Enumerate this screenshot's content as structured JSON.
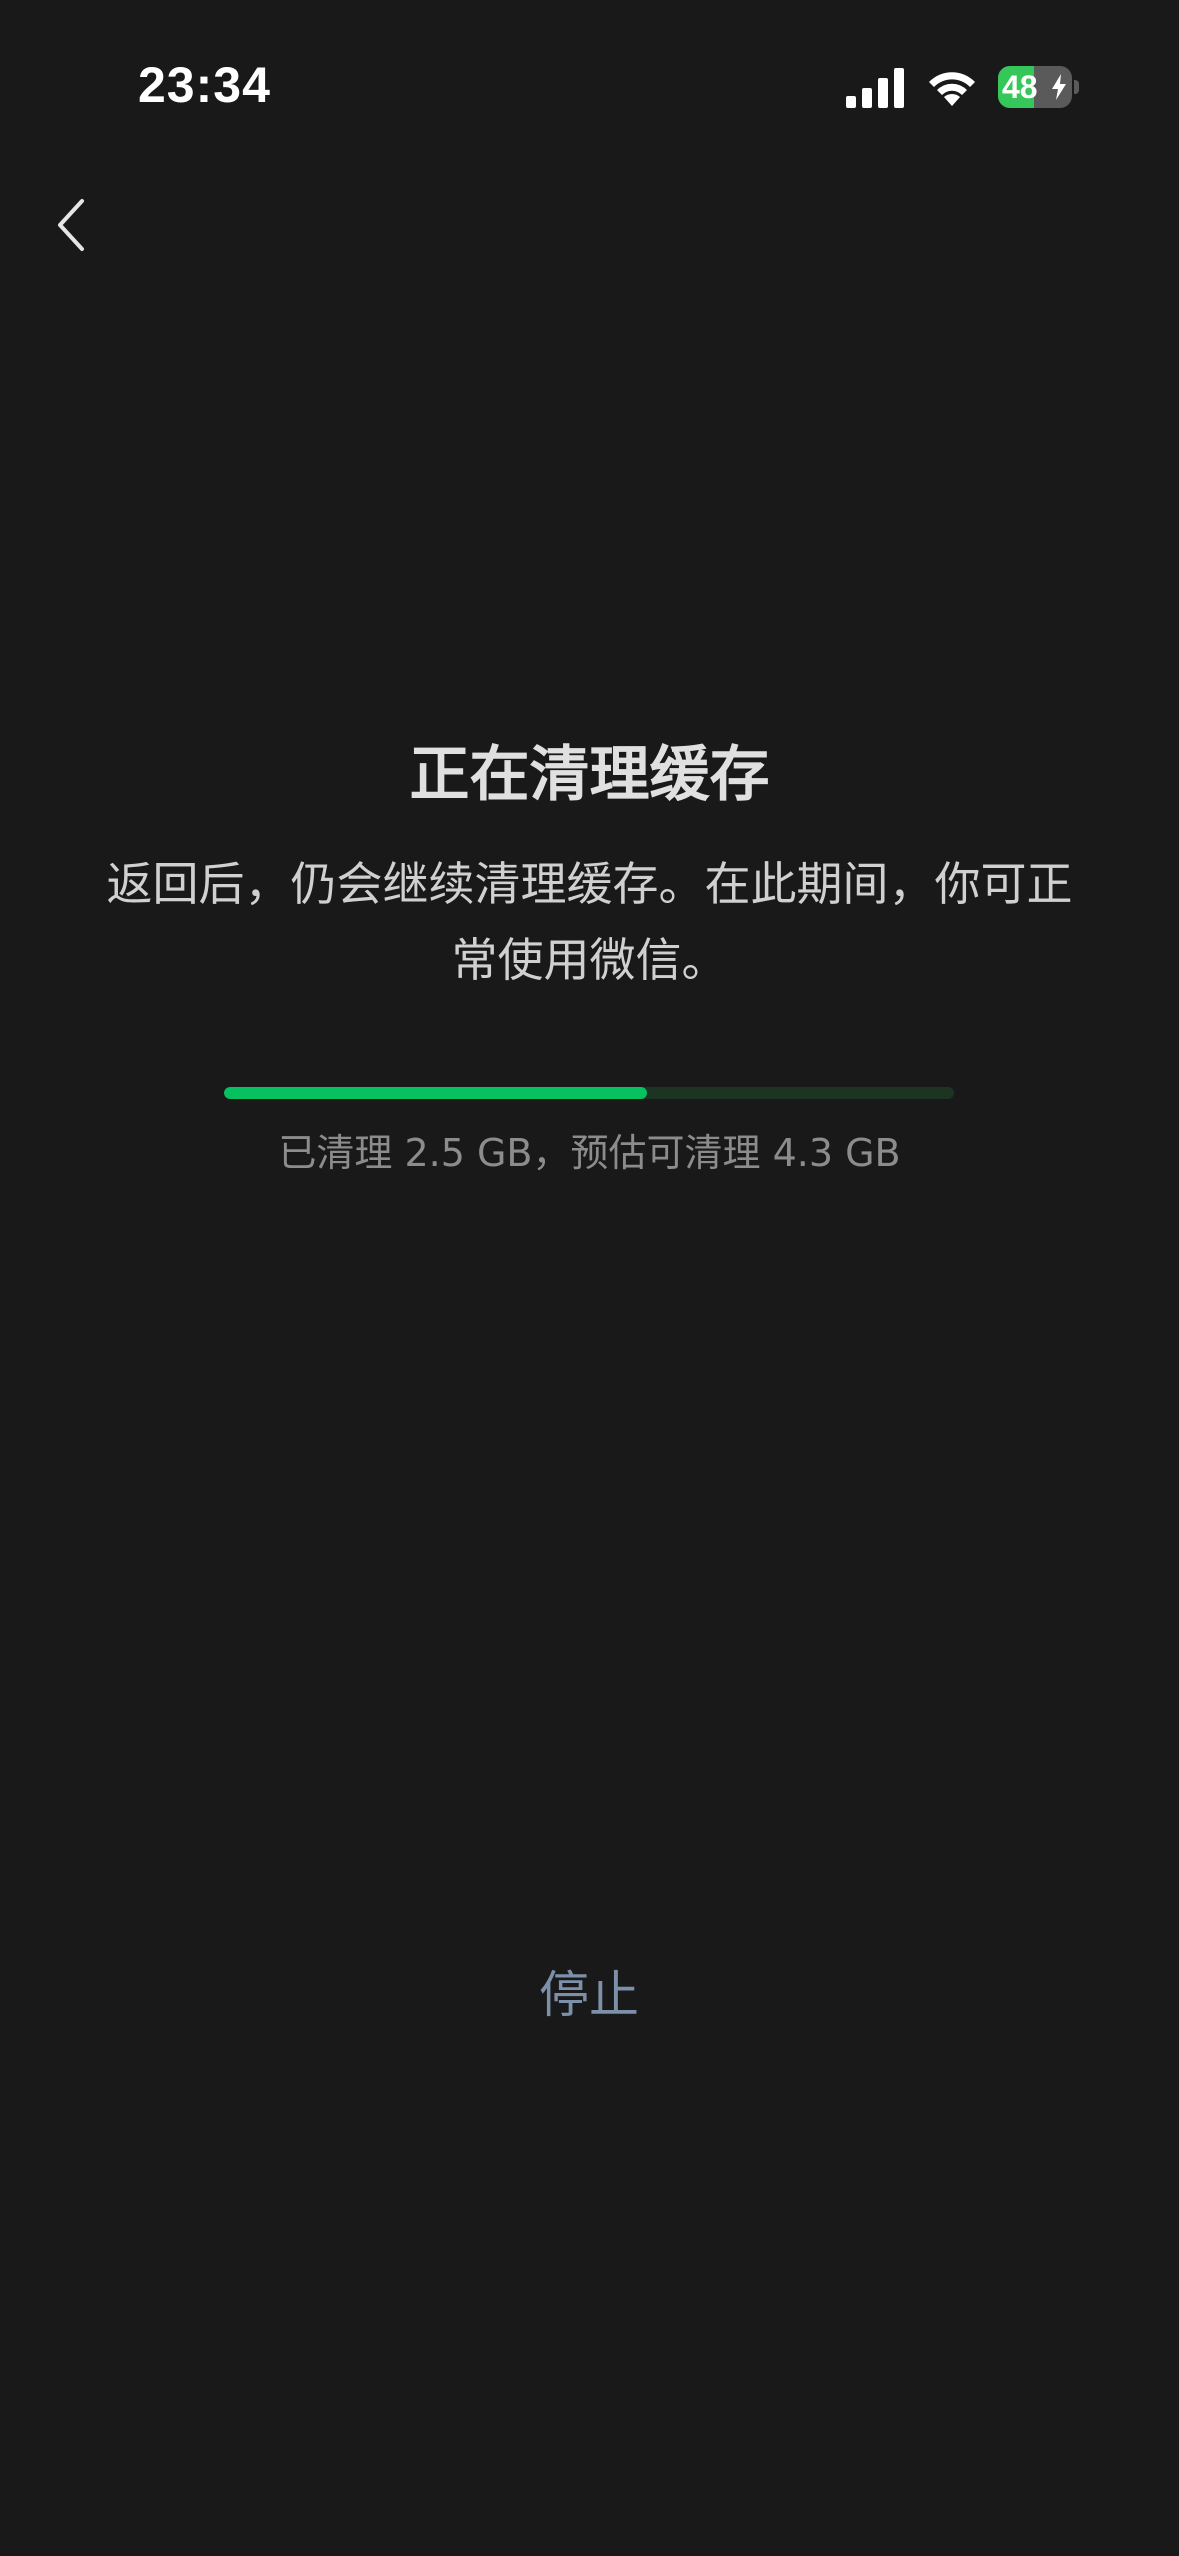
{
  "status_bar": {
    "time": "23:34",
    "battery_level": "48",
    "battery_fraction": 0.48,
    "signal_bars": 4,
    "icons": [
      "signal-icon",
      "wifi-icon",
      "battery-icon",
      "charging-bolt-icon"
    ]
  },
  "nav": {
    "back_icon": "chevron-left-icon"
  },
  "content": {
    "title": "正在清理缓存",
    "description": "返回后，仍会继续清理缓存。在此期间，你可正常使用微信。",
    "progress_text": "已清理 2.5 GB，预估可清理 4.3 GB",
    "progress_fraction": 0.58
  },
  "actions": {
    "stop_label": "停止"
  },
  "colors": {
    "background": "#191919",
    "accent_green": "#07c160",
    "track": "#1d3423",
    "stop_text": "#7d90a9",
    "battery_green": "#35c759"
  }
}
